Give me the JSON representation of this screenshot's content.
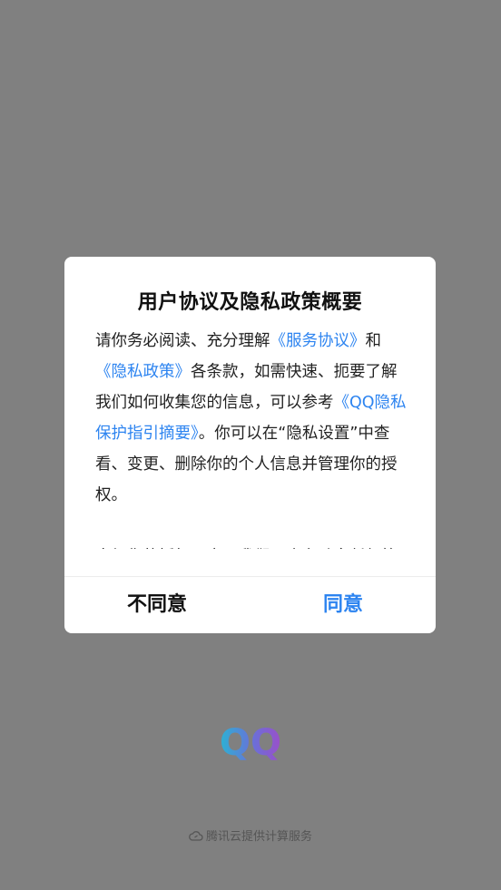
{
  "dialog": {
    "title": "用户协议及隐私政策概要",
    "para1": {
      "t1": "请你务必阅读、充分理解",
      "link1": "《服务协议》",
      "t2": "和",
      "link2": "《隐私政策》",
      "t3": "各条款，如需快速、扼要了解我们如何收集您的信息，可以参考",
      "link3": "《QQ隐私保护指引摘要》",
      "t4": "。你可以在“隐私设置”中查看、变更、删除你的个人信息并管理你的授权。"
    },
    "para2": "未经你的授权同意，我们不会主动向任何第三方共享你的个人信息。",
    "disagree_label": "不同意",
    "agree_label": "同意"
  },
  "logo": {
    "text": "QQ",
    "colors": [
      "#2bb3d4",
      "#6b6fd8",
      "#9b4fc9"
    ]
  },
  "footer": {
    "icon": "cloud-icon",
    "text": "腾讯云提供计算服务"
  }
}
